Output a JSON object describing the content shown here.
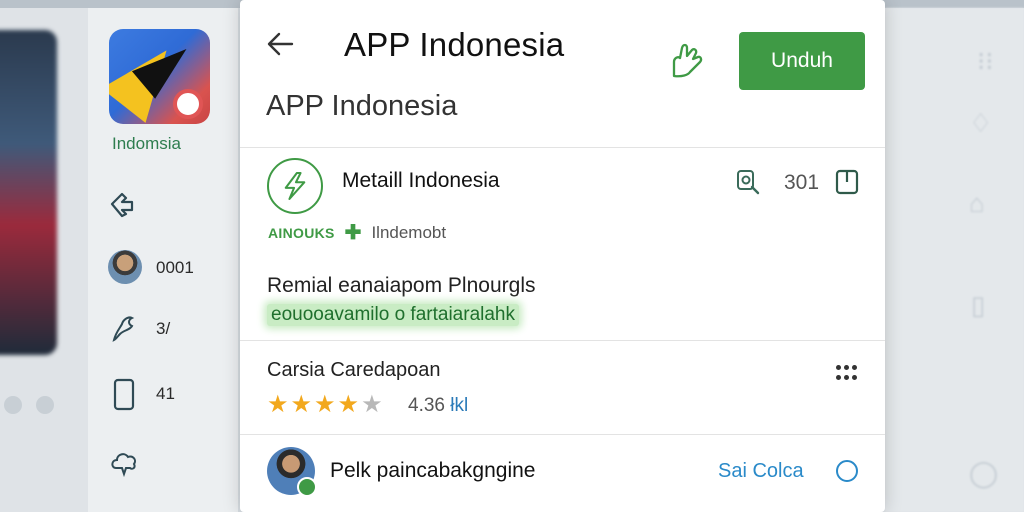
{
  "background": {
    "app_name": "Indomsia",
    "stats": [
      {
        "icon": "avatar",
        "value": "0001"
      },
      {
        "icon": "tool-icon",
        "value": "3/"
      },
      {
        "icon": "device-icon",
        "value": "41"
      }
    ]
  },
  "dialog": {
    "title": "APP Indonesia",
    "subtitle": "APP Indonesia",
    "download_label": "Unduh",
    "developer": {
      "name": "Metaill Indonesia",
      "badge": "AINOUKS",
      "sub": "Ilndemobt",
      "count": "301"
    },
    "description": {
      "title": "Remial eanaiapom Plnourgls",
      "link": "eouooavamilo o fartaiaralahk"
    },
    "rating": {
      "label": "Carsia Caredapoan",
      "value": "4.36",
      "suffix": "łkl",
      "stars": 4
    },
    "review": {
      "text": "Pelk paincabakgngine",
      "see_all": "Sai Colca"
    }
  },
  "colors": {
    "accent": "#3f9a45",
    "link": "#2a8ac9",
    "star": "#f2a81d"
  }
}
